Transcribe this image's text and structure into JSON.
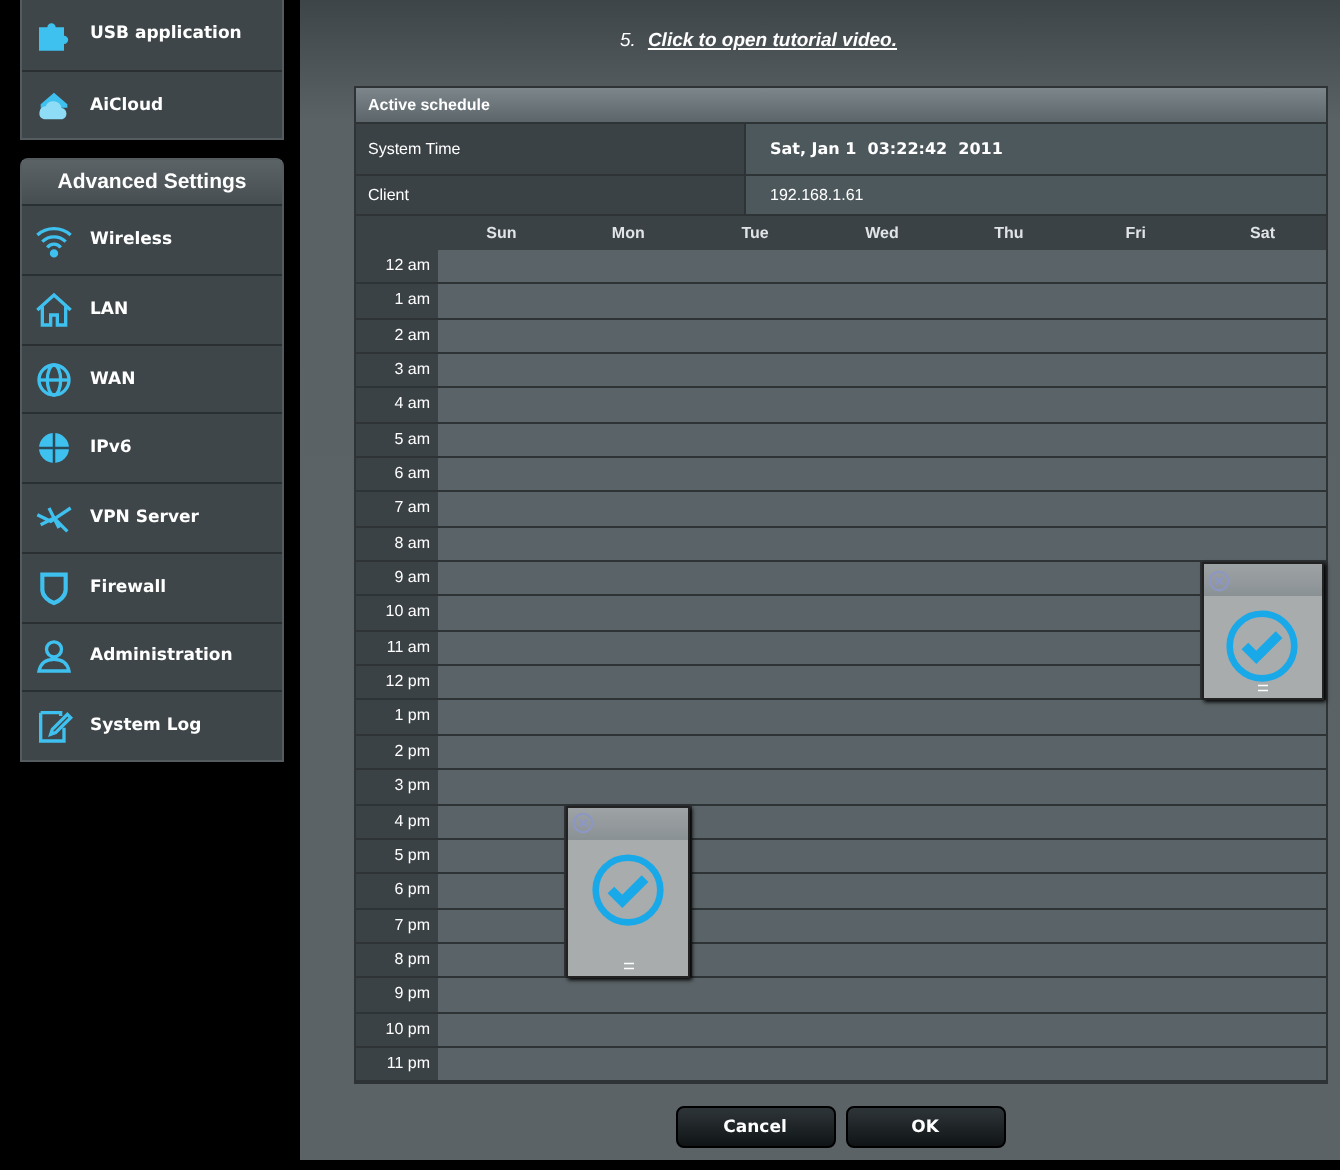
{
  "sidebar": {
    "top_items": [
      {
        "label": "USB application"
      },
      {
        "label": "AiCloud"
      }
    ],
    "section_title": "Advanced Settings",
    "items": [
      {
        "label": "Wireless"
      },
      {
        "label": "LAN"
      },
      {
        "label": "WAN"
      },
      {
        "label": "IPv6"
      },
      {
        "label": "VPN Server"
      },
      {
        "label": "Firewall"
      },
      {
        "label": "Administration"
      },
      {
        "label": "System Log"
      }
    ]
  },
  "instruction": {
    "number": "5.",
    "link": "Click to open tutorial video."
  },
  "schedule": {
    "title": "Active schedule",
    "system_time_label": "System Time",
    "system_time": "Sat, Jan 1  03:22:42  2011",
    "client_label": "Client",
    "client": "192.168.1.61",
    "days": [
      "Sun",
      "Mon",
      "Tue",
      "Wed",
      "Thu",
      "Fri",
      "Sat"
    ],
    "hours": [
      {
        "label": "12 am",
        "days": [
          false,
          false,
          false,
          false,
          false,
          false,
          false
        ]
      },
      {
        "label": "1 am",
        "days": [
          false,
          false,
          false,
          false,
          false,
          false,
          false
        ]
      },
      {
        "label": "2 am",
        "days": [
          false,
          false,
          false,
          false,
          false,
          false,
          false
        ]
      },
      {
        "label": "3 am",
        "days": [
          false,
          false,
          false,
          false,
          false,
          false,
          false
        ]
      },
      {
        "label": "4 am",
        "days": [
          false,
          false,
          false,
          false,
          false,
          false,
          false
        ]
      },
      {
        "label": "5 am",
        "days": [
          false,
          false,
          false,
          false,
          false,
          false,
          false
        ]
      },
      {
        "label": "6 am",
        "days": [
          false,
          false,
          false,
          false,
          false,
          false,
          false
        ]
      },
      {
        "label": "7 am",
        "days": [
          false,
          false,
          false,
          false,
          false,
          false,
          false
        ]
      },
      {
        "label": "8 am",
        "days": [
          false,
          false,
          false,
          false,
          false,
          false,
          false
        ]
      },
      {
        "label": "9 am",
        "days": [
          false,
          false,
          false,
          false,
          false,
          false,
          true
        ]
      },
      {
        "label": "10 am",
        "days": [
          false,
          false,
          false,
          false,
          false,
          false,
          true
        ]
      },
      {
        "label": "11 am",
        "days": [
          false,
          false,
          false,
          false,
          false,
          false,
          true
        ]
      },
      {
        "label": "12 pm",
        "days": [
          false,
          false,
          false,
          false,
          false,
          false,
          true
        ]
      },
      {
        "label": "1 pm",
        "days": [
          false,
          false,
          false,
          false,
          false,
          false,
          false
        ]
      },
      {
        "label": "2 pm",
        "days": [
          false,
          false,
          false,
          false,
          false,
          false,
          false
        ]
      },
      {
        "label": "3 pm",
        "days": [
          false,
          false,
          false,
          false,
          false,
          false,
          false
        ]
      },
      {
        "label": "4 pm",
        "days": [
          false,
          true,
          false,
          false,
          false,
          false,
          false
        ]
      },
      {
        "label": "5 pm",
        "days": [
          false,
          true,
          false,
          false,
          false,
          false,
          false
        ]
      },
      {
        "label": "6 pm",
        "days": [
          false,
          true,
          false,
          false,
          false,
          false,
          false
        ]
      },
      {
        "label": "7 pm",
        "days": [
          false,
          true,
          false,
          false,
          false,
          false,
          false
        ]
      },
      {
        "label": "8 pm",
        "days": [
          false,
          true,
          false,
          false,
          false,
          false,
          false
        ]
      },
      {
        "label": "9 pm",
        "days": [
          false,
          false,
          false,
          false,
          false,
          false,
          false
        ]
      },
      {
        "label": "10 pm",
        "days": [
          false,
          false,
          false,
          false,
          false,
          false,
          false
        ]
      },
      {
        "label": "11 pm",
        "days": [
          false,
          false,
          false,
          false,
          false,
          false,
          false
        ]
      }
    ]
  },
  "buttons": [
    {
      "label": "Cancel"
    },
    {
      "label": "OK"
    }
  ]
}
